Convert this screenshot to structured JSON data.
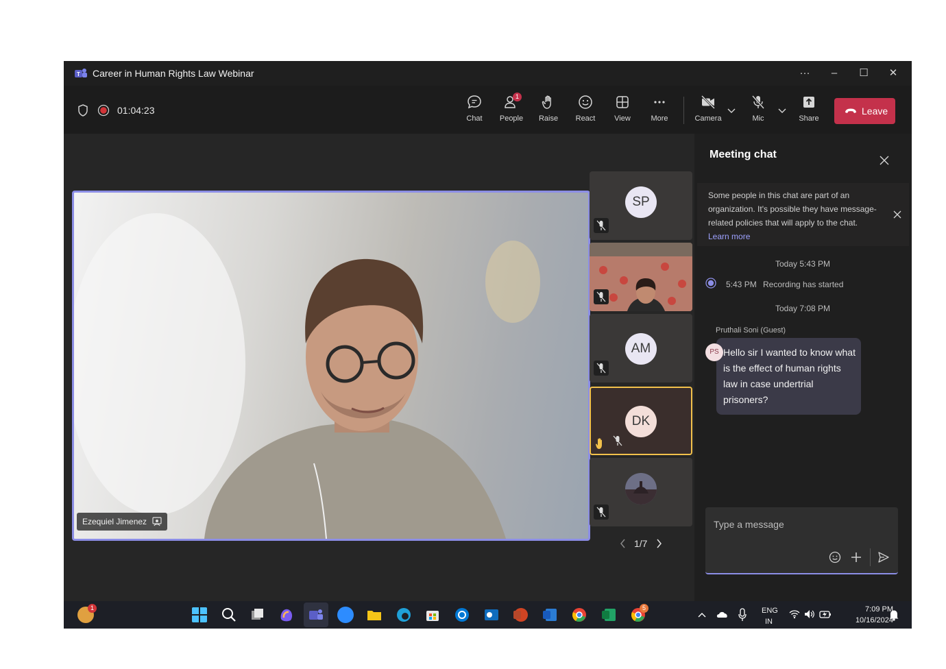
{
  "window": {
    "title": "Career in Human Rights Law Webinar",
    "more": "···",
    "minimize": "–",
    "maximize": "☐",
    "close": "✕"
  },
  "toolbar": {
    "timer": "01:04:23",
    "buttons": [
      {
        "label": "Chat",
        "icon": "chat-icon"
      },
      {
        "label": "People",
        "icon": "people-icon",
        "badge": "1"
      },
      {
        "label": "Raise",
        "icon": "hand-icon"
      },
      {
        "label": "React",
        "icon": "smiley-icon"
      },
      {
        "label": "View",
        "icon": "grid-icon"
      },
      {
        "label": "More",
        "icon": "more-icon"
      },
      {
        "label": "Camera",
        "icon": "camera-off-icon"
      },
      {
        "label": "Mic",
        "icon": "mic-off-icon"
      },
      {
        "label": "Share",
        "icon": "share-icon"
      }
    ],
    "leave": "Leave",
    "colors": {
      "leave": "#c4314b",
      "accent": "#8c8ee6"
    }
  },
  "stage": {
    "speaker_name": "Ezequiel Jimenez",
    "tiles": [
      {
        "initials": "SP"
      },
      {
        "initials": ""
      },
      {
        "initials": "AM"
      },
      {
        "initials": "DK",
        "hand_raised": true
      },
      {
        "initials": ""
      }
    ],
    "pager": "1/7"
  },
  "chat": {
    "title": "Meeting chat",
    "notice": "Some people in this chat are part of an organization. It's possible they have message-related policies that will apply to the chat.",
    "notice_link": "Learn more",
    "events": [
      {
        "time_header": "Today 5:43 PM",
        "time": "5:43 PM",
        "text": "Recording has started"
      }
    ],
    "second_header": "Today 7:08 PM",
    "message": {
      "sender": "Pruthali Soni (Guest)",
      "initials": "PS",
      "text": "Hello sir I wanted to know what is the effect of human rights law in case undertrial prisoners?"
    },
    "compose_placeholder": "Type a message"
  },
  "taskbar": {
    "notification_badge": "1",
    "chrome_badge": "5",
    "lang": "ENG",
    "region": "IN",
    "time": "7:09 PM",
    "date": "10/16/2024"
  }
}
